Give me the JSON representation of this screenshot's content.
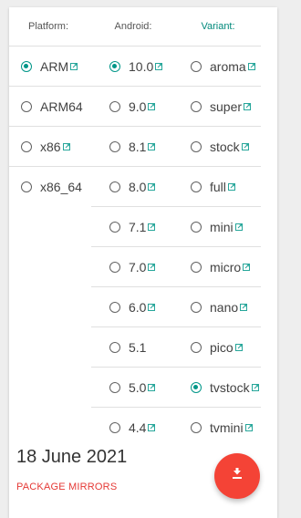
{
  "headers": {
    "platform": "Platform:",
    "android": "Android:",
    "variant": "Variant:"
  },
  "platforms": [
    {
      "label": "ARM",
      "link": true,
      "checked": true
    },
    {
      "label": "ARM64",
      "link": false,
      "checked": false
    },
    {
      "label": "x86",
      "link": true,
      "checked": false
    },
    {
      "label": "x86_64",
      "link": false,
      "checked": false
    }
  ],
  "android_versions": [
    {
      "label": "10.0",
      "link": true,
      "checked": true
    },
    {
      "label": "9.0",
      "link": true,
      "checked": false
    },
    {
      "label": "8.1",
      "link": true,
      "checked": false
    },
    {
      "label": "8.0",
      "link": true,
      "checked": false
    },
    {
      "label": "7.1",
      "link": true,
      "checked": false
    },
    {
      "label": "7.0",
      "link": true,
      "checked": false
    },
    {
      "label": "6.0",
      "link": true,
      "checked": false
    },
    {
      "label": "5.1",
      "link": false,
      "checked": false
    },
    {
      "label": "5.0",
      "link": true,
      "checked": false
    },
    {
      "label": "4.4",
      "link": true,
      "checked": false
    }
  ],
  "variants": [
    {
      "label": "aroma",
      "link": true,
      "checked": false
    },
    {
      "label": "super",
      "link": true,
      "checked": false
    },
    {
      "label": "stock",
      "link": true,
      "checked": false
    },
    {
      "label": "full",
      "link": true,
      "checked": false
    },
    {
      "label": "mini",
      "link": true,
      "checked": false
    },
    {
      "label": "micro",
      "link": true,
      "checked": false
    },
    {
      "label": "nano",
      "link": true,
      "checked": false
    },
    {
      "label": "pico",
      "link": true,
      "checked": false
    },
    {
      "label": "tvstock",
      "link": true,
      "checked": true
    },
    {
      "label": "tvmini",
      "link": true,
      "checked": false
    }
  ],
  "footer": {
    "date": "18 June 2021",
    "mirrors_label": "PACKAGE MIRRORS",
    "download_icon": "download-icon"
  },
  "colors": {
    "accent": "#009688",
    "link_icon": "#26a69a",
    "fab": "#f44336",
    "mirrors_text": "#e53935"
  }
}
